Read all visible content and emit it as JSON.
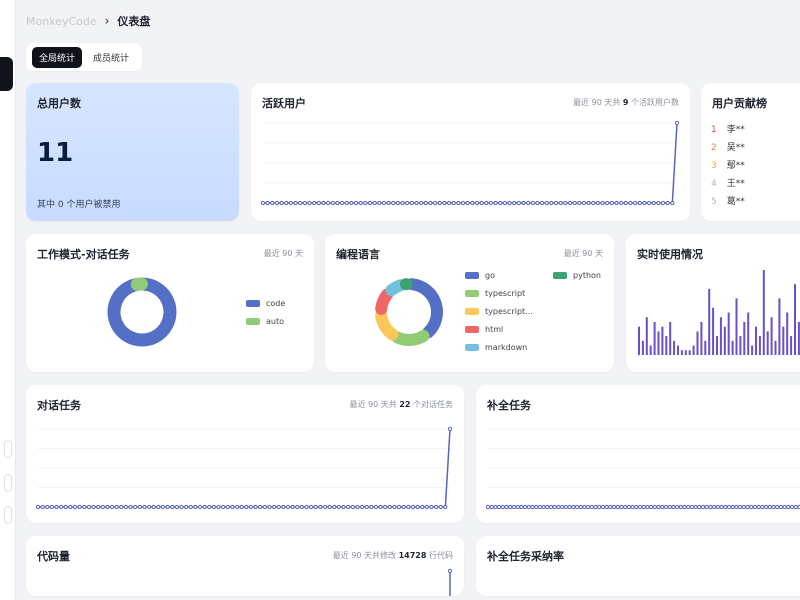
{
  "app_name": "MonkeyCode",
  "page_title": "仪表盘",
  "tabs": [
    {
      "label": "全局统计",
      "active": true
    },
    {
      "label": "成员统计",
      "active": false
    }
  ],
  "total_users": {
    "title": "总用户数",
    "value": "11",
    "subtitle": "其中 0 个用户被禁用"
  },
  "active_users": {
    "title": "活跃用户",
    "meta_prefix": "最近 90 天共",
    "meta_value": "9",
    "meta_suffix": "个活跃用户数"
  },
  "contrib": {
    "title": "用户贡献榜",
    "items": [
      {
        "rank": "1",
        "name": "李**"
      },
      {
        "rank": "2",
        "name": "吴**"
      },
      {
        "rank": "3",
        "name": "鄢**"
      },
      {
        "rank": "4",
        "name": "王**"
      },
      {
        "rank": "5",
        "name": "葛**"
      }
    ]
  },
  "work_mode": {
    "title": "工作模式-对话任务",
    "meta": "最近 90 天",
    "legend": [
      {
        "label": "code",
        "color": "#5470c6"
      },
      {
        "label": "auto",
        "color": "#91cc75"
      }
    ],
    "slices": [
      {
        "label": "code",
        "value": 97,
        "color": "#5470c6"
      },
      {
        "label": "auto",
        "value": 3,
        "color": "#91cc75"
      }
    ]
  },
  "languages": {
    "title": "编程语言",
    "meta": "最近 90 天",
    "legend": [
      {
        "label": "go",
        "color": "#5470c6"
      },
      {
        "label": "python",
        "color": "#3ba272"
      },
      {
        "label": "typescript",
        "color": "#91cc75"
      },
      {
        "label": "typescript...",
        "color": "#fac858"
      },
      {
        "label": "html",
        "color": "#ee6666"
      },
      {
        "label": "markdown",
        "color": "#73c0de"
      }
    ],
    "slices": [
      {
        "label": "go",
        "value": 38,
        "color": "#5470c6"
      },
      {
        "label": "typescript",
        "value": 18,
        "color": "#91cc75"
      },
      {
        "label": "typescript...",
        "value": 16,
        "color": "#fac858"
      },
      {
        "label": "html",
        "value": 12,
        "color": "#ee6666"
      },
      {
        "label": "markdown",
        "value": 9,
        "color": "#73c0de"
      },
      {
        "label": "python",
        "value": 3,
        "color": "#3ba272"
      }
    ]
  },
  "realtime": {
    "title": "实时使用情况",
    "bars": [
      6,
      3,
      8,
      2,
      7,
      5,
      6,
      4,
      7,
      3,
      2,
      1,
      1,
      1,
      2,
      5,
      7,
      3,
      14,
      10,
      4,
      8,
      6,
      9,
      3,
      12,
      4,
      7,
      9,
      2,
      6,
      4,
      18,
      5,
      8,
      3,
      12,
      6,
      9,
      4,
      15,
      7,
      3
    ]
  },
  "chat_tasks": {
    "title": "对话任务",
    "meta_prefix": "最近 90 天共",
    "meta_value": "22",
    "meta_suffix": "个对话任务"
  },
  "completion_tasks": {
    "title": "补全任务"
  },
  "code_lines": {
    "title": "代码量",
    "meta_prefix": "最近 90 天共修改",
    "meta_value": "14728",
    "meta_suffix": "行代码"
  },
  "completion_rate": {
    "title": "补全任务采纳率"
  },
  "colors": {
    "accent": "#5b64b8",
    "dark": "#11131a",
    "total_bg": "#cfe0ff"
  }
}
